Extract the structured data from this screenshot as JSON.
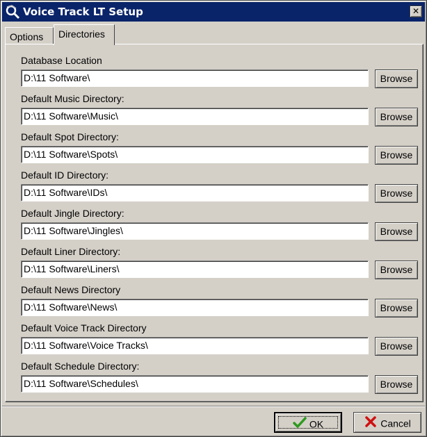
{
  "window": {
    "title": "Voice Track LT Setup",
    "close_glyph": "✕"
  },
  "tabs": [
    {
      "label": "Options",
      "active": false
    },
    {
      "label": "Directories",
      "active": true
    }
  ],
  "directories": [
    {
      "label": "Database Location",
      "value": "D:\\11 Software\\"
    },
    {
      "label": "Default Music Directory:",
      "value": "D:\\11 Software\\Music\\"
    },
    {
      "label": "Default Spot Directory:",
      "value": "D:\\11 Software\\Spots\\"
    },
    {
      "label": "Default ID Directory:",
      "value": "D:\\11 Software\\IDs\\"
    },
    {
      "label": "Default Jingle Directory:",
      "value": "D:\\11 Software\\Jingles\\"
    },
    {
      "label": "Default Liner Directory:",
      "value": "D:\\11 Software\\Liners\\"
    },
    {
      "label": "Default News Directory",
      "value": "D:\\11 Software\\News\\"
    },
    {
      "label": "Default Voice Track Directory",
      "value": "D:\\11 Software\\Voice Tracks\\"
    },
    {
      "label": "Default Schedule Directory:",
      "value": "D:\\11 Software\\Schedules\\"
    }
  ],
  "browse_label": "Browse",
  "buttons": {
    "ok_label": "OK",
    "ok_icon": "checkmark-icon",
    "cancel_label": "Cancel",
    "cancel_icon": "red-x-icon"
  },
  "colors": {
    "titlebar": "#0a246a",
    "face": "#d4d0c8",
    "ok_check": "#2e9a1e",
    "cancel_x": "#d01010"
  }
}
